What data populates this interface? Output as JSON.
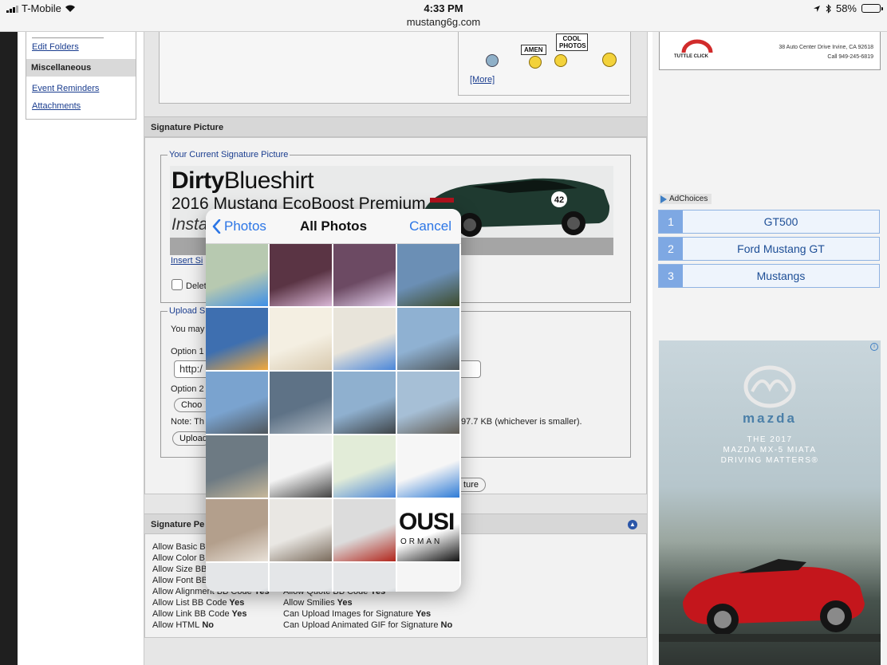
{
  "status_bar": {
    "carrier": "T-Mobile",
    "time": "4:33 PM",
    "url": "mustang6g.com",
    "battery": "58%",
    "battery_level": 0.58
  },
  "sidebar": {
    "items": [
      {
        "label": "Edit Folders"
      },
      {
        "label": "Miscellaneous",
        "header": true
      },
      {
        "label": "Event Reminders"
      },
      {
        "label": "Attachments"
      }
    ]
  },
  "smilies": {
    "labels": [
      "AMEN",
      "COOL PHOTOS"
    ],
    "more_link": "[More]"
  },
  "signature_picture": {
    "section_title": "Signature Picture",
    "current_legend": "Your Current Signature Picture",
    "banner_name_bold": "Dirty",
    "banner_name_rest": "Blueshirt",
    "banner_subtitle": "2016 Mustang EcoBoost Premium",
    "banner_insta": "Instag",
    "car_number": "42",
    "insert_link": "Insert Si",
    "delete_label": "Delet",
    "upload_legend": "Upload S",
    "you_may": "You may",
    "option1": "Option 1",
    "option1_value": "http:/",
    "option2": "Option 2",
    "choose_btn": "Choo",
    "note": "Note: Th",
    "note_tail": "97.7 KB (whichever is smaller).",
    "upload_btn": "Upload",
    "save_btn_tail": "ture"
  },
  "permissions": {
    "section_title": "Signature Pe",
    "left": [
      {
        "label": "Allow Basic B",
        "value": ""
      },
      {
        "label": "Allow Color B",
        "value": ""
      },
      {
        "label": "Allow Size BB",
        "value": ""
      },
      {
        "label": "Allow Font BB",
        "value": ""
      },
      {
        "label": "Allow Alignment BB Code",
        "value": "Yes"
      },
      {
        "label": "Allow List BB Code",
        "value": "Yes"
      },
      {
        "label": "Allow Link BB Code",
        "value": "Yes"
      },
      {
        "label": "Allow HTML",
        "value": "No"
      }
    ],
    "right": [
      {
        "label": "Allow Quote BB Code",
        "value": "Yes"
      },
      {
        "label": "Allow Smilies",
        "value": "Yes"
      },
      {
        "label": "Can Upload Images for Signature",
        "value": "Yes"
      },
      {
        "label": "Can Upload Animated GIF for Signature",
        "value": "No"
      }
    ]
  },
  "ads": {
    "top_brand": "TUTTLE CLICK",
    "top_address": "38 Auto Center Drive Irvine, CA 92618",
    "top_phone": "Call 949-245-6819",
    "adchoices": "AdChoices",
    "keywords": [
      {
        "num": "1",
        "label": "GT500"
      },
      {
        "num": "2",
        "label": "Ford Mustang GT"
      },
      {
        "num": "3",
        "label": "Mustangs"
      }
    ],
    "mazda_brand": "mazda",
    "mazda_tag1": "THE 2017",
    "mazda_tag2": "MAZDA MX-5 MIATA",
    "mazda_tag3": "DRIVING MATTERS®"
  },
  "photo_picker": {
    "back_label": "Photos",
    "title": "All Photos",
    "cancel_label": "Cancel",
    "thumbs": [
      {
        "color": "#b7c9b0",
        "accent": "#3e8fe6"
      },
      {
        "color": "#5a3444",
        "accent": "#d9b7d6"
      },
      {
        "color": "#6c4a63",
        "accent": "#e5d1ee"
      },
      {
        "color": "#6b8fb5",
        "accent": "#3d4b2c"
      },
      {
        "color": "#3e6fb0",
        "accent": "#f2a93c"
      },
      {
        "color": "#f4efe2",
        "accent": "#d8c9ae"
      },
      {
        "color": "#e8e4da",
        "accent": "#4a86d9"
      },
      {
        "color": "#8fb1d2",
        "accent": "#4d5559"
      },
      {
        "color": "#7aa3cf",
        "accent": "#4f565c"
      },
      {
        "color": "#5e7286",
        "accent": "#b0bac4"
      },
      {
        "color": "#8fb0cf",
        "accent": "#3e4448"
      },
      {
        "color": "#a6bfd6",
        "accent": "#5f5a52"
      },
      {
        "color": "#6d7a83",
        "accent": "#c7b89a"
      },
      {
        "color": "#f3f3f3",
        "accent": "#444444"
      },
      {
        "color": "#e2ecd8",
        "accent": "#4a86d9"
      },
      {
        "color": "#f6f6f6",
        "accent": "#2e7bd6"
      },
      {
        "color": "#b39f8c",
        "accent": "#e8e1d8"
      },
      {
        "color": "#e9e7e3",
        "accent": "#7a6b5c"
      },
      {
        "color": "#dcdcdc",
        "accent": "#b2261c"
      },
      {
        "color": "#ffffff",
        "accent": "#111111"
      },
      {
        "color": "#e4e6e8",
        "accent": "#6b7b8c"
      },
      {
        "color": "#e4e6e8",
        "accent": "#6b7b8c"
      },
      {
        "color": "#e4e6e8",
        "accent": "#6b7b8c"
      },
      {
        "color": "#f5f5f5",
        "accent": "#f5f5f5"
      }
    ],
    "thumb_text": {
      "8": "",
      "19": "OUSI",
      "19b": "ORMAN"
    }
  },
  "colors": {
    "link": "#1a3d8f",
    "ios_blue": "#2c76e6",
    "ad_keyword": "#1d4e96"
  }
}
